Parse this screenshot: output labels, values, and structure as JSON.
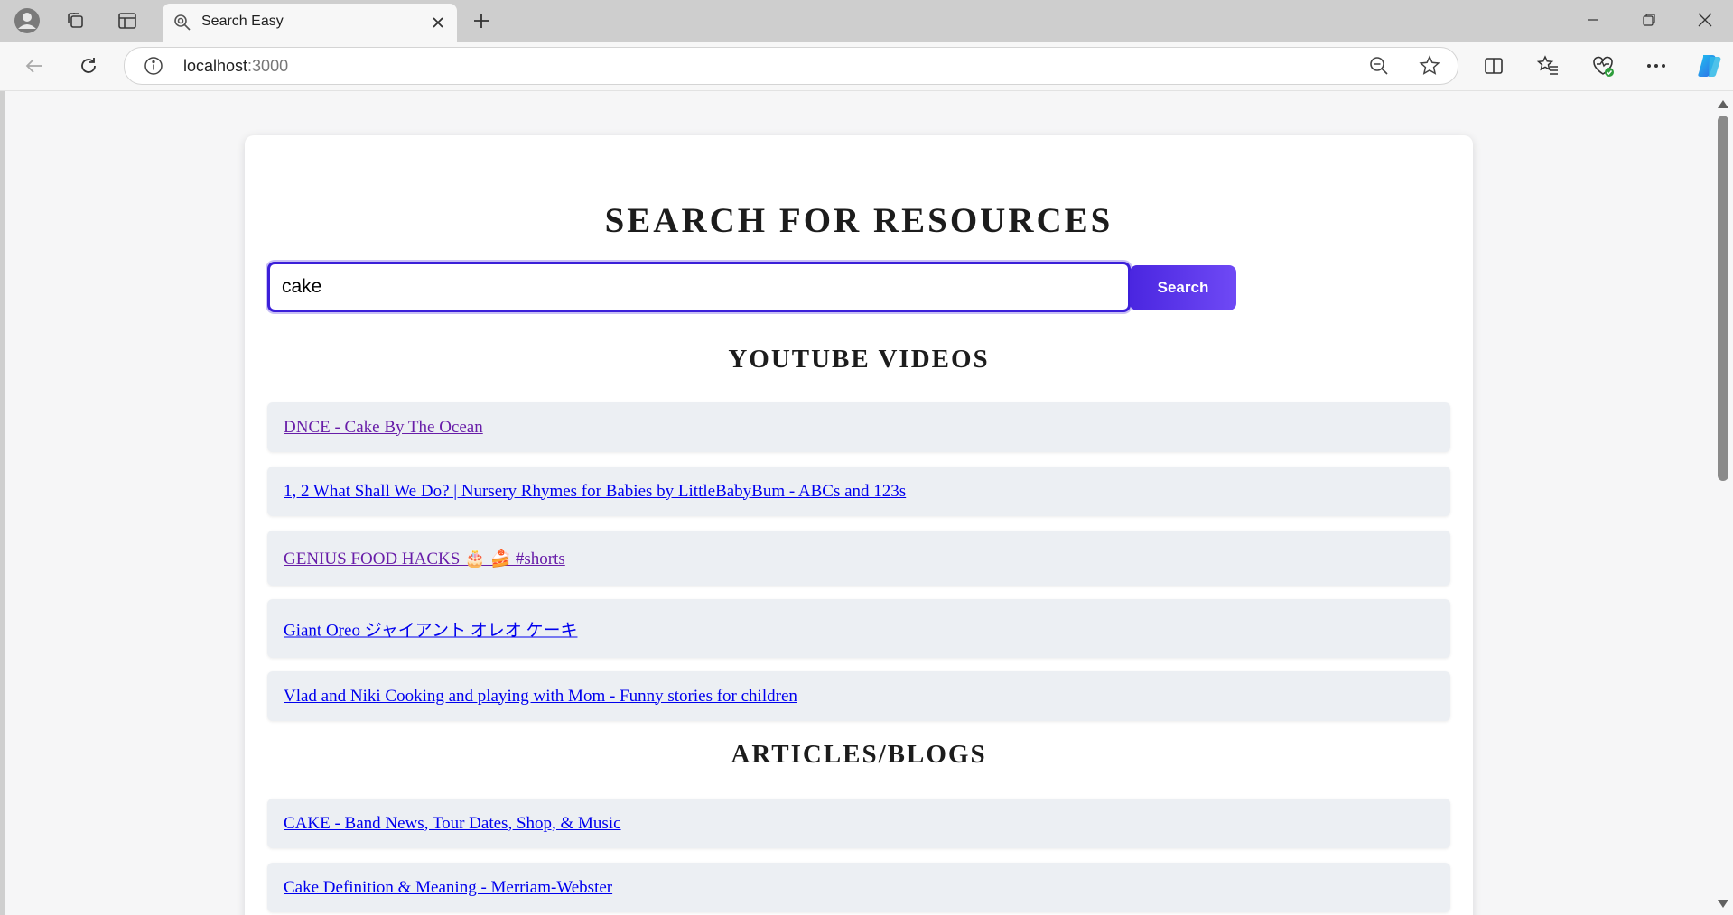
{
  "browser": {
    "tab": {
      "title": "Search Easy"
    },
    "address": {
      "host": "localhost",
      "port": ":3000"
    }
  },
  "page": {
    "title": "SEARCH FOR RESOURCES",
    "search": {
      "value": "cake",
      "button_label": "Search"
    },
    "youtube": {
      "heading": "YOUTUBE VIDEOS",
      "items": [
        {
          "label": "DNCE - Cake By The Ocean",
          "visited": true
        },
        {
          "label": "1, 2 What Shall We Do? | Nursery Rhymes for Babies by LittleBabyBum - ABCs and 123s",
          "visited": false
        },
        {
          "label": "GENIUS FOOD HACKS 🎂 🍰 #shorts",
          "visited": true
        },
        {
          "label": "Giant Oreo ジャイアント オレオ ケーキ",
          "visited": false
        },
        {
          "label": "Vlad and Niki Cooking and playing with Mom - Funny stories for children",
          "visited": false
        }
      ]
    },
    "articles": {
      "heading": "ARTICLES/BLOGS",
      "items": [
        {
          "label": "CAKE - Band News, Tour Dates, Shop, & Music",
          "visited": false
        },
        {
          "label": "Cake Definition & Meaning - Merriam-Webster",
          "visited": false
        }
      ]
    }
  },
  "colors": {
    "accent": "#3b1fd9",
    "button_gradient_start": "#4a26e0",
    "button_gradient_end": "#6f49f5",
    "result_background": "#eceff3",
    "link": "#0000ee",
    "link_visited": "#681da8"
  },
  "icons": {
    "profile": "profile-icon",
    "workspaces": "workspaces-icon",
    "vertical_tabs": "vertical-tabs-icon",
    "favicon": "search-favicon-icon",
    "close": "close-icon",
    "new_tab": "plus-icon",
    "back": "back-arrow-icon",
    "refresh": "refresh-icon",
    "info": "info-icon",
    "zoom": "zoom-out-icon",
    "favorite": "star-icon",
    "split": "split-screen-icon",
    "favorites": "favorites-icon",
    "health": "browser-essentials-icon",
    "more": "more-icon",
    "copilot": "copilot-icon"
  }
}
